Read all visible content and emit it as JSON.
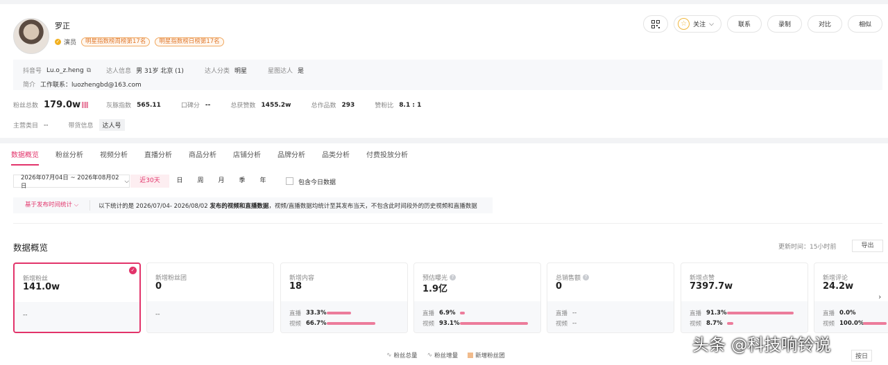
{
  "profile": {
    "name": "罗正",
    "role": "演员",
    "rank_tags": [
      "明星指数榜周榜第17名",
      "明星指数榜日榜第17名"
    ],
    "info": {
      "douyin_id_label": "抖音号",
      "douyin_id": "Lu.o_z.heng",
      "talent_info_label": "达人信息",
      "talent_info": "男 31岁 北京 (1)",
      "category_label": "达人分类",
      "category": "明星",
      "xingtu_label": "星图达人",
      "xingtu": "是",
      "bio_label": "简介",
      "bio": "工作联系：luozhengbd@163.com"
    },
    "stats": [
      {
        "label": "粉丝总数",
        "value": "179.0w"
      },
      {
        "label": "灰豚指数",
        "value": "565.11"
      },
      {
        "label": "口碑分",
        "value": "--"
      },
      {
        "label": "总获赞数",
        "value": "1455.2w"
      },
      {
        "label": "总作品数",
        "value": "293"
      },
      {
        "label": "赞粉比",
        "value": "8.1 : 1"
      }
    ],
    "main_category_label": "主营类目",
    "main_category": "--",
    "goods_label": "带货信息",
    "goods": "达人号"
  },
  "actions": {
    "follow": "关注",
    "contact": "联系",
    "record": "录制",
    "compare": "对比",
    "similar": "相似"
  },
  "tabs": [
    "数据概览",
    "粉丝分析",
    "视频分析",
    "直播分析",
    "商品分析",
    "店铺分析",
    "品牌分析",
    "品类分析",
    "付费投放分析"
  ],
  "filter": {
    "date_range": "2026年07月04日 ~ 2026年08月02日",
    "quick": [
      "近30天",
      "日",
      "周",
      "月",
      "季",
      "年"
    ],
    "include_today": "包含今日数据"
  },
  "notice": {
    "basis": "基于发布时间统计",
    "text_pre": "以下统计的是 2026/07/04- 2026/08/02 ",
    "text_bold": "发布的视频和直播数据",
    "text_post": "，视频/直播数据均统计至其发布当天，不包含此时间段外的历史视频和直播数据"
  },
  "overview": {
    "title": "数据概览",
    "updated": "更新时间：15小时前",
    "export": "导出",
    "cards": [
      {
        "title": "新增粉丝",
        "value": "141.0w",
        "dash": "--"
      },
      {
        "title": "新增粉丝团",
        "value": "0",
        "dash": "--"
      },
      {
        "title": "新增内容",
        "value": "18",
        "live_pct": "33.3%",
        "video_pct": "66.7%",
        "live_frac": 0.333,
        "video_frac": 0.667
      },
      {
        "title": "预估曝光",
        "value": "1.9亿",
        "live_pct": "6.9%",
        "video_pct": "93.1%",
        "live_frac": 0.069,
        "video_frac": 0.931
      },
      {
        "title": "总销售额",
        "value": "0",
        "live_dash": "--",
        "video_dash": "--"
      },
      {
        "title": "新增点赞",
        "value": "7397.7w",
        "live_pct": "91.3%",
        "video_pct": "8.7%",
        "live_frac": 0.913,
        "video_frac": 0.087
      },
      {
        "title": "新增评论",
        "value": "24.2w",
        "live_pct": "0.0%",
        "video_pct": "100.0%",
        "live_frac": 0.0,
        "video_frac": 1.0
      }
    ],
    "live_label": "直播",
    "video_label": "视频"
  },
  "legend": [
    "粉丝总量",
    "粉丝增量",
    "新增粉丝团"
  ],
  "sort_label": "按日",
  "watermark": "头条 @科技响铃说"
}
